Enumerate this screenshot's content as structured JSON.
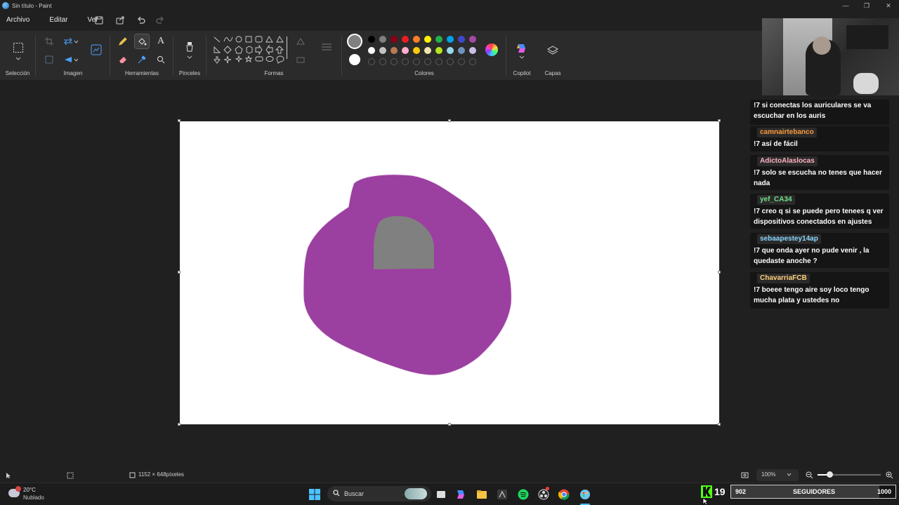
{
  "window": {
    "title": "Sin título - Paint"
  },
  "menu": {
    "file": "Archivo",
    "edit": "Editar",
    "view": "Ver"
  },
  "ribbon": {
    "groups": {
      "selection": "Selección",
      "image": "Imagen",
      "tools": "Herramientas",
      "brushes": "Pinceles",
      "shapes": "Formas",
      "colors": "Colores",
      "copilot": "Copilot",
      "layers": "Capas"
    },
    "palette_row1": [
      "#000000",
      "#7f7f7f",
      "#880015",
      "#ed1c24",
      "#ff7f27",
      "#fff200",
      "#22b14c",
      "#00a2e8",
      "#3f48cc",
      "#a349a4"
    ],
    "palette_row2": [
      "#ffffff",
      "#c3c3c3",
      "#b97a57",
      "#ffaec9",
      "#ffc90e",
      "#efe4b0",
      "#b5e61d",
      "#99d9ea",
      "#7092be",
      "#c8bfe7"
    ],
    "color1": "#808080",
    "color2": "#ffffff"
  },
  "canvas": {
    "blob_color": "#9b3fa0",
    "inner_color": "#808080"
  },
  "status": {
    "size": "1152 × 648píxeles",
    "zoom": "100%"
  },
  "taskbar": {
    "weather_temp": "20°C",
    "weather_desc": "Nublado",
    "search_placeholder": "Buscar"
  },
  "overlay": {
    "kick_count": "19",
    "followers_current": "902",
    "followers_label": "SEGUIDORES",
    "followers_goal": "1000"
  },
  "chat": [
    {
      "user": "",
      "user_color": "#ffffff",
      "text": "!7 si conectas los auriculares se va escuchar en los auris"
    },
    {
      "user": "camnairtebanco",
      "user_color": "#ff9a3c",
      "text": "!7 así de fácil"
    },
    {
      "user": "AdictoAlaslocas",
      "user_color": "#ffb0c0",
      "text": "!7 solo se escucha no tenes que hacer nada"
    },
    {
      "user": "yef_CA34",
      "user_color": "#6fe28a",
      "text": "!7 creo q si se puede pero tenees q ver dispositivos conectados en ajustes"
    },
    {
      "user": "sebaapestey14ap",
      "user_color": "#8ad7ff",
      "text": "!7 que onda ayer no pude venir , la quedaste anoche ?"
    },
    {
      "user": "ChavarriaFCB",
      "user_color": "#ffcf7a",
      "text": "!7 boeee tengo aire soy loco tengo mucha plata y ustedes no"
    }
  ]
}
